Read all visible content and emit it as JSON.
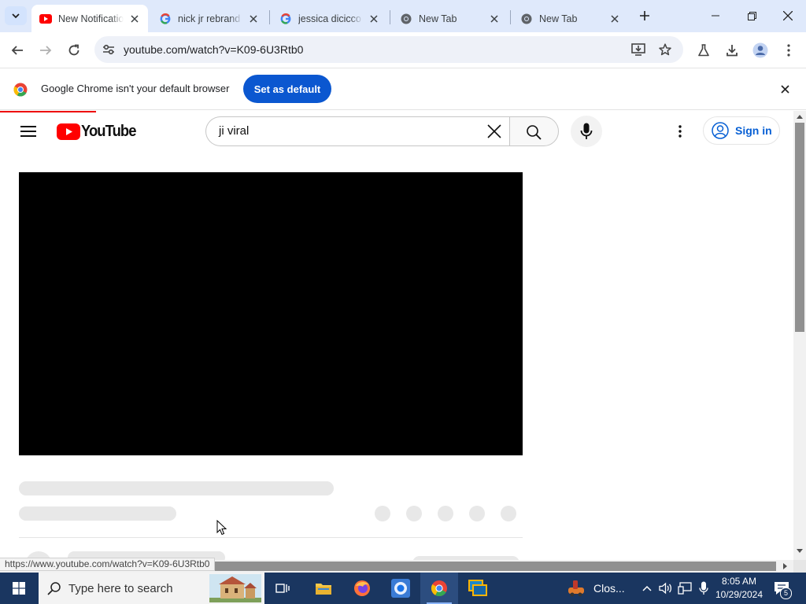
{
  "browser": {
    "tabs": [
      {
        "title": "New Notification",
        "favicon": "youtube-icon",
        "active": true
      },
      {
        "title": "nick jr rebrand",
        "favicon": "google-icon",
        "active": false
      },
      {
        "title": "jessica dicicco",
        "favicon": "google-icon",
        "active": false
      },
      {
        "title": "New Tab",
        "favicon": "chrome-icon",
        "active": false
      },
      {
        "title": "New Tab",
        "favicon": "chrome-icon",
        "active": false
      }
    ],
    "url": "youtube.com/watch?v=K09-6U3Rtb0",
    "infobar": {
      "message": "Google Chrome isn't your default browser",
      "button": "Set as default"
    },
    "status_url": "https://www.youtube.com/watch?v=K09-6U3Rtb0"
  },
  "youtube": {
    "logo_text": "YouTube",
    "search_query": "ji viral",
    "sign_in": "Sign in"
  },
  "taskbar": {
    "search_placeholder": "Type here to search",
    "weather_label": "Clos...",
    "time": "8:05 AM",
    "date": "10/29/2024",
    "notification_count": "5"
  },
  "colors": {
    "chrome_accent": "#0b57d0",
    "youtube_red": "#ff0000",
    "taskbar": "#1a3660"
  }
}
